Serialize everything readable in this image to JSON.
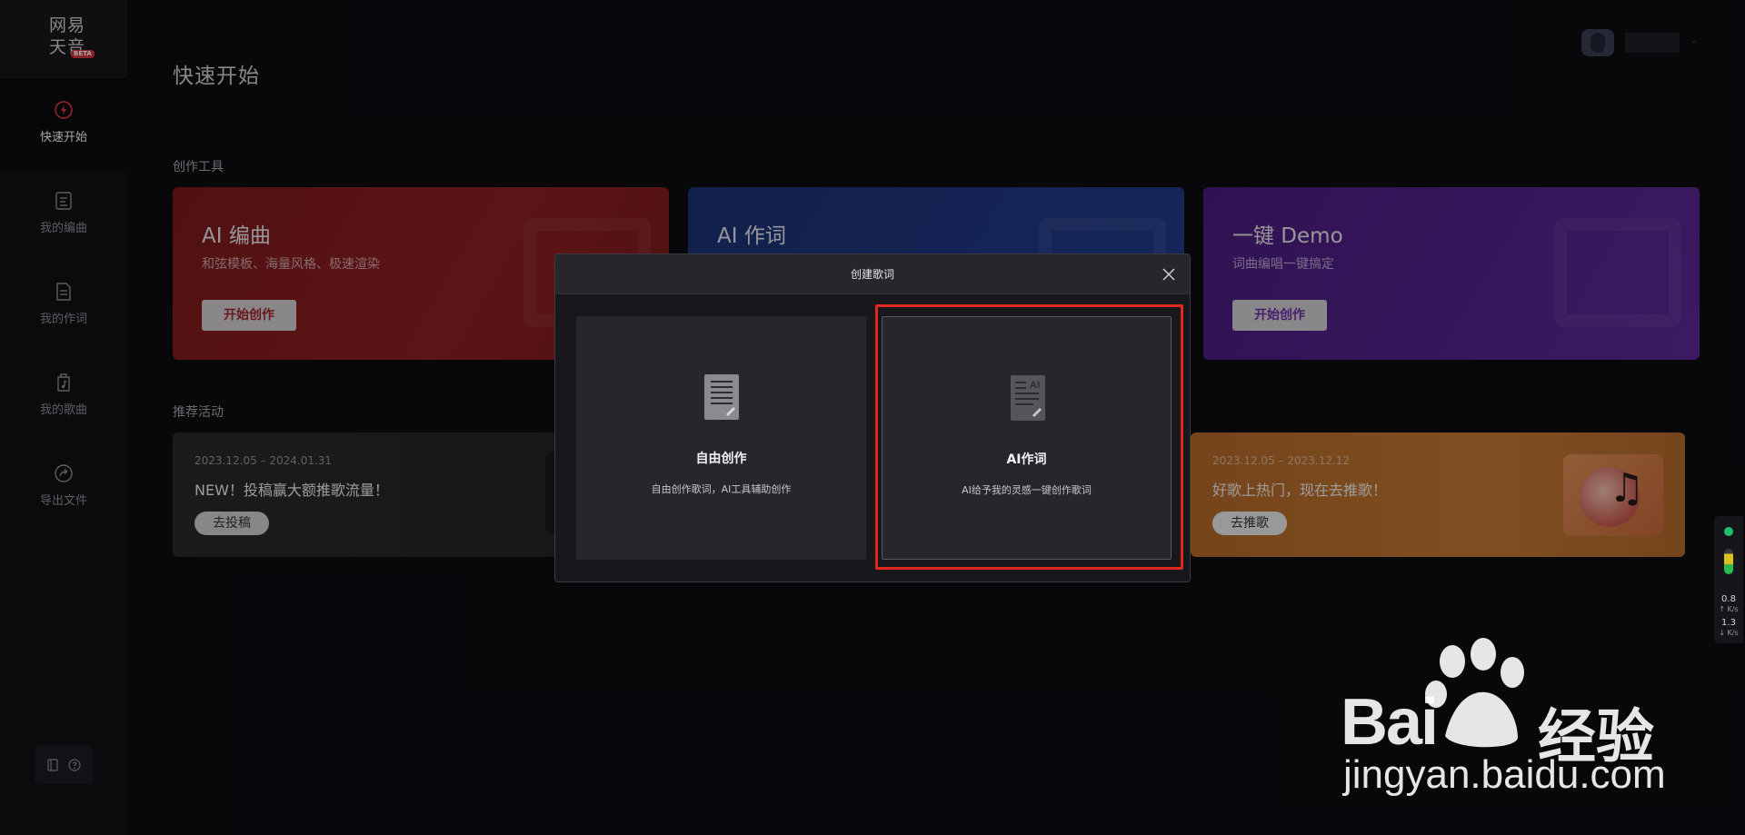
{
  "logo": {
    "line1": "网易",
    "line2": "天音",
    "beta": "BETA"
  },
  "sidebar": {
    "items": [
      {
        "label": "快速开始",
        "icon": "lightning-icon",
        "active": true
      },
      {
        "label": "我的编曲",
        "icon": "score-icon",
        "active": false
      },
      {
        "label": "我的作词",
        "icon": "document-icon",
        "active": false
      },
      {
        "label": "我的歌曲",
        "icon": "music-file-icon",
        "active": false
      },
      {
        "label": "导出文件",
        "icon": "share-icon",
        "active": false
      }
    ],
    "footer_icons": [
      "book-icon",
      "help-icon"
    ]
  },
  "header": {
    "title": "快速开始"
  },
  "sections": {
    "tools_label": "创作工具",
    "activities_label": "推荐活动"
  },
  "tools": [
    {
      "title": "AI 编曲",
      "subtitle": "和弦模板、海量风格、极速渲染",
      "button": "开始创作",
      "color": "#8f2124"
    },
    {
      "title": "AI 作词",
      "subtitle": "",
      "button": "",
      "color": "#213c8c"
    },
    {
      "title": "一键 Demo",
      "subtitle": "词曲编唱一键搞定",
      "button": "开始创作",
      "color": "#5c2896"
    }
  ],
  "activities": [
    {
      "date": "2023.12.05 – 2024.01.31",
      "title": "NEW！投稿赢大额推歌流量！",
      "button": "去投稿"
    },
    {
      "date": "2023.12.05 – 2023.12.12",
      "title": "好歌上热门，现在去推歌！",
      "button": "去推歌"
    }
  ],
  "modal": {
    "title": "创建歌词",
    "close_icon": "close-icon",
    "options": [
      {
        "title": "自由创作",
        "desc": "自由创作歌词，AI工具辅助创作",
        "icon": "document-pen-icon"
      },
      {
        "title": "AI作词",
        "desc": "AI给予我的灵感一键创作歌词",
        "icon": "ai-document-icon",
        "highlighted": true
      }
    ],
    "highlight_color": "#e0281f"
  },
  "net_widget": {
    "up_value": "0.8",
    "up_unit": "↑ K/s",
    "down_value": "1.3",
    "down_unit": "↓ K/s"
  },
  "watermark": {
    "brand": "Bai",
    "suffix": "经验",
    "url": "jingyan.baidu.com"
  }
}
